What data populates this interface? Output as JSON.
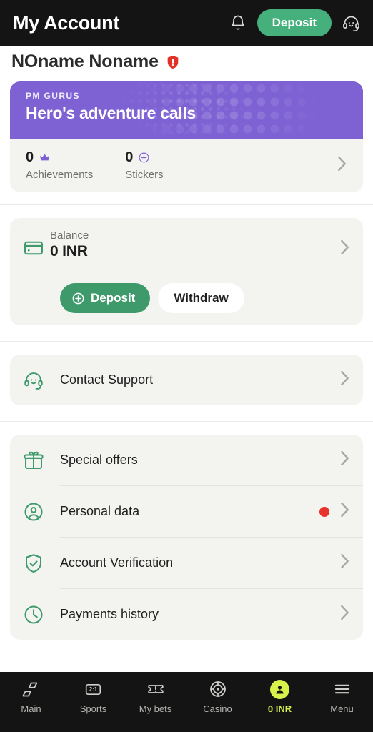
{
  "header": {
    "title": "My Account",
    "bell_icon": "bell-icon",
    "deposit_label": "Deposit",
    "support_icon": "headset-icon"
  },
  "account": {
    "name": "NOname Noname",
    "warning_icon": "shield-exclamation-icon"
  },
  "promo": {
    "kicker": "PM GURUS",
    "title": "Hero's adventure calls",
    "banner_color": "#7E62D4",
    "stats": [
      {
        "value": "0",
        "label": "Achievements",
        "icon": "crown-icon"
      },
      {
        "value": "0",
        "label": "Stickers",
        "icon": "sticker-plus-icon"
      }
    ],
    "chevron_icon": "chevron-right-icon"
  },
  "balance": {
    "icon": "credit-card-icon",
    "label": "Balance",
    "value": "0 INR",
    "chevron_icon": "chevron-right-icon",
    "deposit_label": "Deposit",
    "deposit_icon": "plus-circle-icon",
    "withdraw_label": "Withdraw",
    "deposit_color": "#3E9A6B"
  },
  "support": {
    "label": "Contact Support",
    "icon": "headset-icon",
    "chevron_icon": "chevron-right-icon"
  },
  "menu": {
    "items": [
      {
        "label": "Special offers",
        "icon": "gift-icon",
        "badge": false
      },
      {
        "label": "Personal data",
        "icon": "user-circle-icon",
        "badge": true
      },
      {
        "label": "Account Verification",
        "icon": "shield-check-icon",
        "badge": false
      },
      {
        "label": "Payments history",
        "icon": "clock-icon",
        "badge": false
      }
    ],
    "badge_color": "#E8322B",
    "icon_color": "#3E9A6B"
  },
  "bottom_nav": {
    "active_color": "#D8F14B",
    "items": [
      {
        "label": "Main",
        "icon": "parallelograms-icon",
        "active": false
      },
      {
        "label": "Sports",
        "icon": "scoreboard-2-1-icon",
        "active": false
      },
      {
        "label": "My bets",
        "icon": "ticket-icon",
        "active": false
      },
      {
        "label": "Casino",
        "icon": "poker-chip-icon",
        "active": false
      },
      {
        "label": "0 INR",
        "icon": "user-avatar-icon",
        "active": true
      },
      {
        "label": "Menu",
        "icon": "hamburger-icon",
        "active": false
      }
    ]
  }
}
